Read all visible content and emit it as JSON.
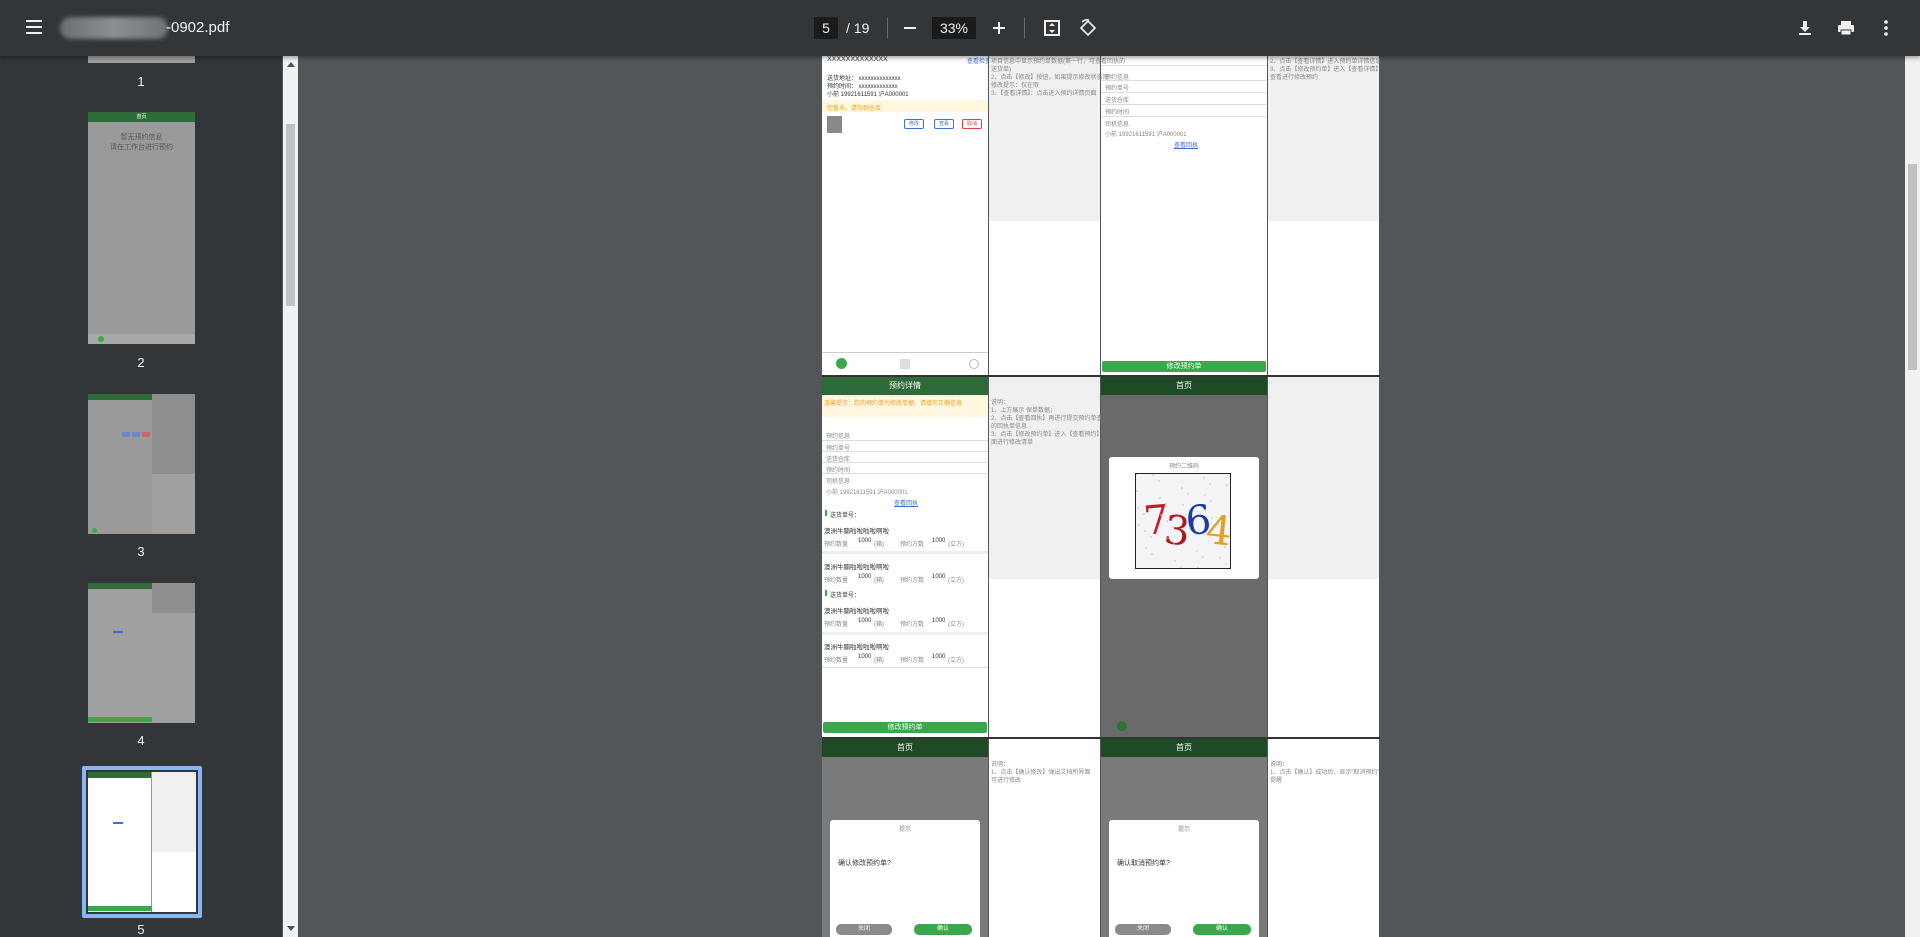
{
  "toolbar": {
    "title": "-0902.pdf",
    "page_current": "5",
    "page_total": "/ 19",
    "zoom": "33%"
  },
  "sidebar": {
    "pages": [
      "1",
      "2",
      "3",
      "4",
      "5"
    ],
    "thumb2_line1": "暂无预约信息",
    "thumb2_line2": "请在工作台进行预约",
    "thumb2_header": "首页"
  },
  "doc": {
    "cell_a": {
      "code": "XXXXXXXXXXXXX",
      "link": "查看检查",
      "addr": "送货地址：  xxxxxxxxxxxxxx",
      "time": "预约时间：  xxxxxxxxxxxxx",
      "person": "小前    19921611591  沪A000001",
      "warn": "您暂未，请勿到仓库",
      "btn_modify": "修改",
      "btn_view": "查看",
      "btn_cancel": "取消"
    },
    "notes_a": [
      "项目信息中显示预约单数据(第一行，可查看回执的",
      "送货单)",
      "2、点击【修改】按钮，如果提示修改状态则",
      "修改提示：仅在取",
      "3、【查看详情】：点击进入预约详情页面"
    ],
    "cell_b": {
      "rows": [
        "预约信息",
        "预约单号",
        "送货仓库",
        "预约时间",
        "司机信息"
      ],
      "person": "小前    19921611591  沪A000001",
      "link": "查看回执",
      "btn": "修改预约单"
    },
    "notes_b": [
      "2、点击【查看详情】进入预约单详情信息",
      "3、点击【修改预约单】进入【查看详情】界面",
      "查看进行修改预约"
    ],
    "detail": {
      "header": "预约详情",
      "warn": "温馨提示：您的预约单为修改单据，请填写正确信息",
      "rows": [
        "预约信息",
        "预约单号",
        "送货仓库",
        "预约时间",
        "司机信息"
      ],
      "person": "小前    19921611591  沪A000001",
      "link": "查看回执",
      "order1": "送货单号：",
      "item_title": "澳洲牛腩啦啦啦啦啊啦",
      "qty_label": "预约数量",
      "qty_value": "1000",
      "qty_unit": "(箱)",
      "vol_label": "预约方数",
      "vol_value": "1000",
      "vol_unit": "(立方)",
      "order2": "送货单号：",
      "btn": "修改预约单"
    },
    "notes_detail": [
      "说明：",
      "1、上方展示 保单数据；",
      "2、点击【查看回执】再进行提交预约单查看",
      "的回执单信息",
      "3、点击【修改预约单】进入【查看预约】界面",
      "面进行修改清单"
    ],
    "qr": {
      "header": "首页",
      "dialog_title": "预约二维码",
      "captcha": [
        "7",
        "3",
        "6",
        "4"
      ],
      "captcha_colors": [
        "#c0202a",
        "#b01820",
        "#1a3aa8",
        "#e0a020"
      ]
    },
    "confirm_modify": {
      "header": "首页",
      "title": "提示",
      "message": "确认修改预约单?",
      "btn_close": "关闭",
      "btn_ok": "确认"
    },
    "notes_modify": [
      "说明：",
      "1、点击【确认修改】弹出文档所界面",
      "可进行修改"
    ],
    "confirm_cancel": {
      "header": "首页",
      "title": "提示",
      "message": "确认取消预约单?",
      "btn_close": "关闭",
      "btn_ok": "确认"
    },
    "notes_cancel": [
      "说明：",
      "1、点击【确认】成功后，显示“取消预约”",
      "提醒"
    ]
  }
}
